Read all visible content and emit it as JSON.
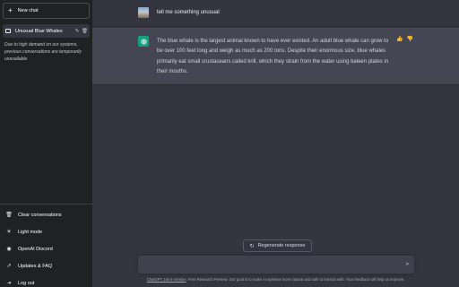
{
  "sidebar": {
    "new_chat": "New chat",
    "conversation_title": "Unusual Blue Whales",
    "notice": "Due to high demand on our systems, previous conversations are temporarily unavailable",
    "bottom_items": [
      {
        "label": "Clear conversations",
        "icon": "trash-icon"
      },
      {
        "label": "Light mode",
        "icon": "sun-icon"
      },
      {
        "label": "OpenAI Discord",
        "icon": "discord-icon"
      },
      {
        "label": "Updates & FAQ",
        "icon": "external-link-icon"
      },
      {
        "label": "Log out",
        "icon": "logout-icon"
      }
    ]
  },
  "chat": {
    "user_message": "tell me something unusual",
    "assistant_message": "The blue whale is the largest animal known to have ever existed. An adult blue whale can grow to be over 100 feet long and weigh as much as 200 tons. Despite their enormous size, blue whales primarily eat small crustaceans called krill, which they strain from the water using baleen plates in their mouths."
  },
  "regenerate_label": "Regenerate response",
  "input": {
    "placeholder": ""
  },
  "footer": {
    "link": "ChatGPT Jan 9 Version",
    "text": ". Free Research Preview. Our goal is to make AI systems more natural and safe to interact with. Your feedback will help us improve."
  },
  "colors": {
    "accent": "#10a37f",
    "sidebar": "#202123",
    "main": "#343541",
    "assistant_row": "#444654"
  }
}
